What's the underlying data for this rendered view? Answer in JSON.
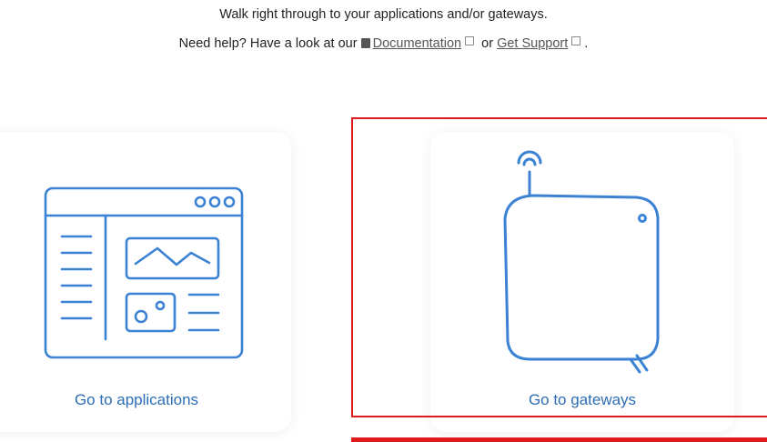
{
  "intro": {
    "line1": "Walk right through to your applications and/or gateways.",
    "help_prefix": "Need help? Have a look at our",
    "doc_link": "Documentation",
    "or_text": "or",
    "support_link": "Get Support",
    "end": "."
  },
  "cards": {
    "applications": {
      "label": "Go to applications",
      "icon": "application-window-icon"
    },
    "gateways": {
      "label": "Go to gateways",
      "icon": "gateway-device-icon"
    }
  },
  "colors": {
    "accent": "#2c6db6",
    "icon_stroke": "#3b82d4",
    "highlight": "#e01b1b"
  }
}
